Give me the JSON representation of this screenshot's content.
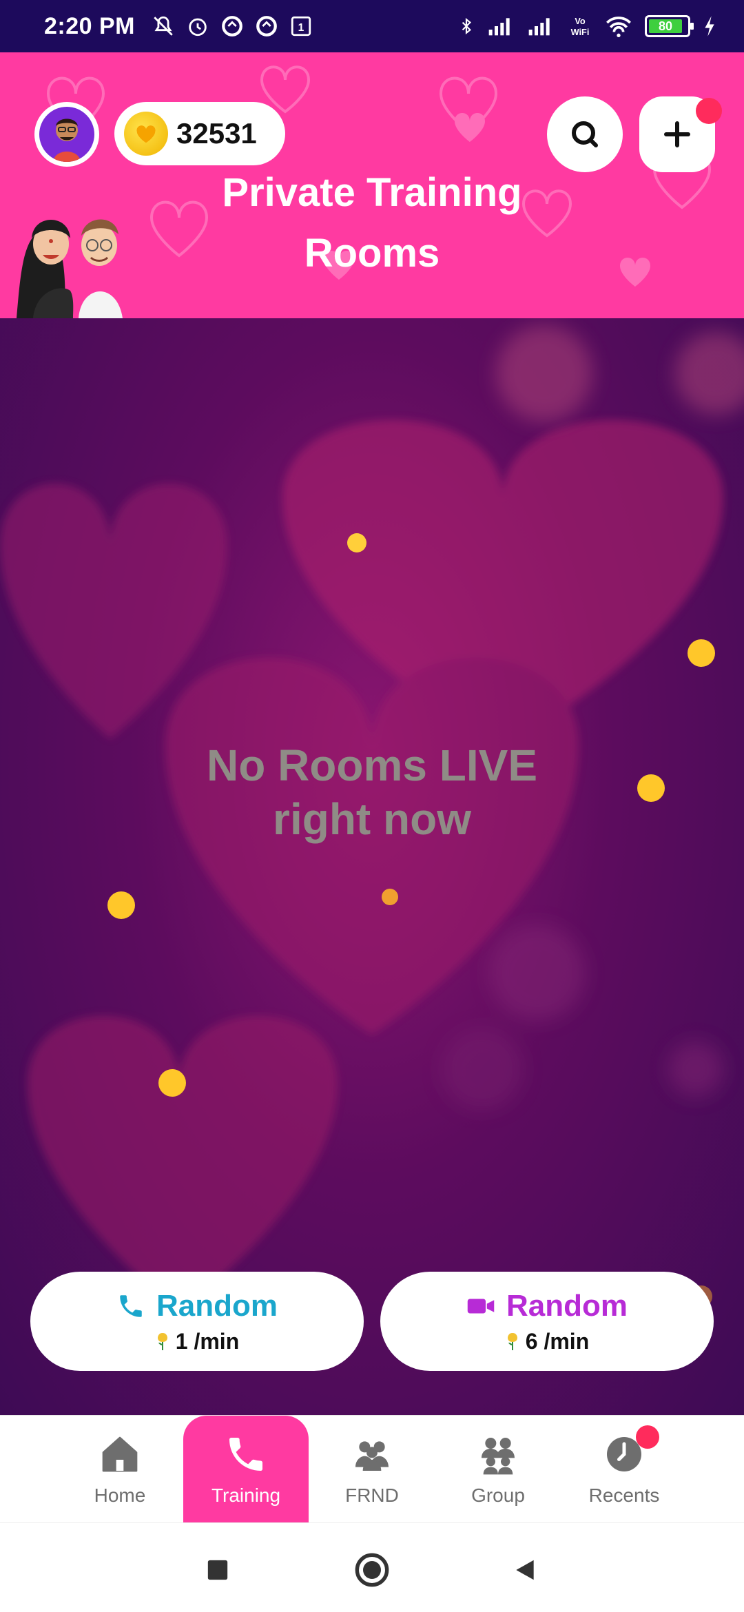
{
  "status_bar": {
    "time": "2:20 PM",
    "battery": "80",
    "icons_left": [
      "mute-bell-icon",
      "alarm-icon",
      "data-saver-icon",
      "data-saver-icon",
      "notification-1-icon"
    ],
    "icons_right": [
      "bluetooth-icon",
      "signal-icon",
      "signal-icon",
      "vowifi-icon",
      "wifi-icon",
      "battery-icon",
      "charging-icon"
    ]
  },
  "header": {
    "coins": "32531",
    "title_line1": "Private Training",
    "title_line2": "Rooms",
    "background_color": "#ff3aa1"
  },
  "main": {
    "empty_line1": "No Rooms LIVE",
    "empty_line2": "right now"
  },
  "random_buttons": [
    {
      "label": "Random",
      "rate": "1 /min",
      "icon": "phone-icon",
      "color": "#1aa6cc"
    },
    {
      "label": "Random",
      "rate": "6 /min",
      "icon": "video-camera-icon",
      "color": "#b72bd6"
    }
  ],
  "bottom_nav": {
    "items": [
      {
        "label": "Home",
        "icon": "home-icon",
        "active": false
      },
      {
        "label": "Training",
        "icon": "phone-icon",
        "active": true
      },
      {
        "label": "FRND",
        "icon": "friends-icon",
        "active": false
      },
      {
        "label": "Group",
        "icon": "group-icon",
        "active": false
      },
      {
        "label": "Recents",
        "icon": "clock-icon",
        "active": false
      }
    ]
  },
  "system_nav": [
    "recents-square-icon",
    "home-circle-icon",
    "back-triangle-icon"
  ]
}
